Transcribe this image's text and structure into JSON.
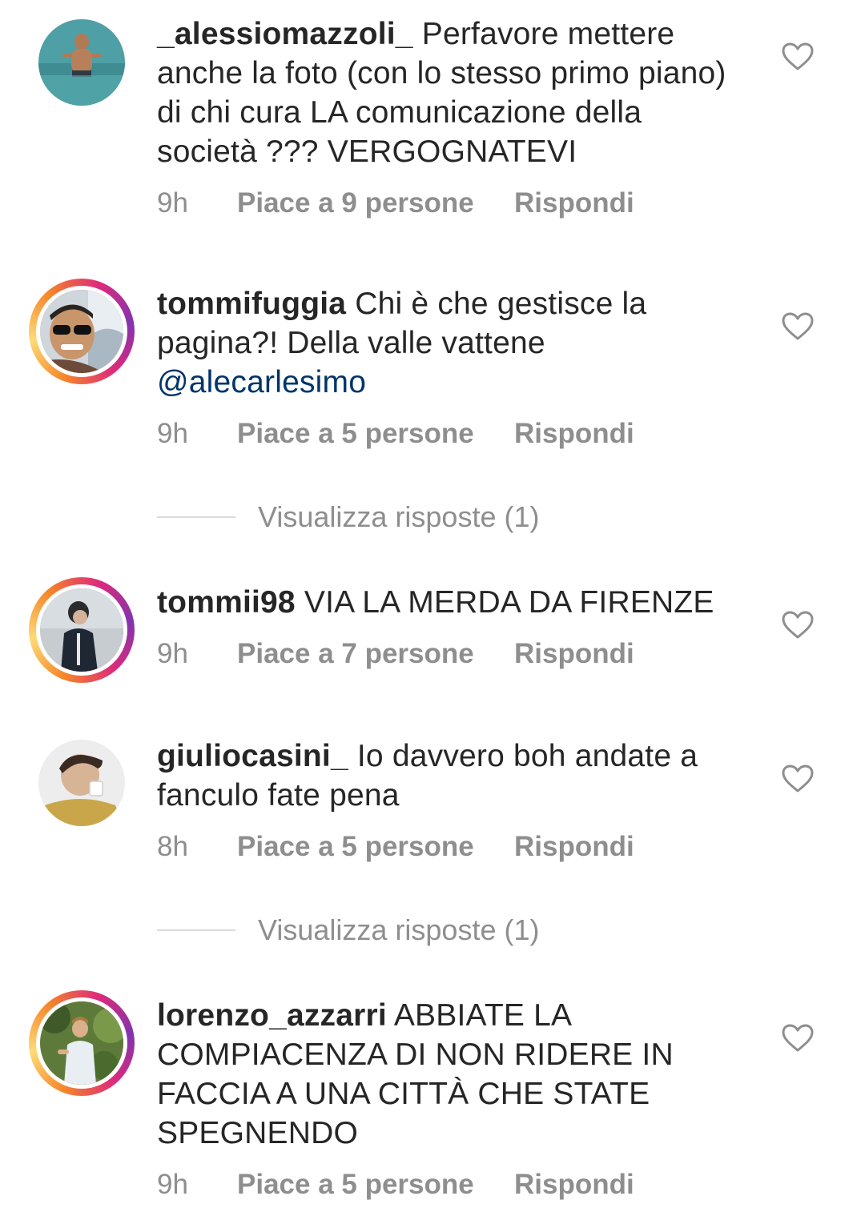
{
  "comments": [
    {
      "username": "_alessiomazzoli_",
      "text": "Perfavore mettere anche la foto (con lo stesso primo piano) di chi cura LA comunicazione della società ??? VERGOGNATEVI",
      "time": "9h",
      "likes": "Piace a 9 persone",
      "reply": "Rispondi"
    },
    {
      "username": "tommifuggia",
      "text": "Chi è che gestisce la pagina?! Della valle vattene",
      "mention": "@alecarlesimo",
      "time": "9h",
      "likes": "Piace a 5 persone",
      "reply": "Rispondi",
      "view_replies": "Visualizza risposte (1)"
    },
    {
      "username": "tommii98",
      "text": "VIA LA MERDA DA FIRENZE",
      "time": "9h",
      "likes": "Piace a 7 persone",
      "reply": "Rispondi"
    },
    {
      "username": "giuliocasini_",
      "text": "Io davvero boh andate a fanculo fate pena",
      "time": "8h",
      "likes": "Piace a 5 persone",
      "reply": "Rispondi",
      "view_replies": "Visualizza risposte (1)"
    },
    {
      "username": "lorenzo_azzarri",
      "text": "ABBIATE LA COMPIACENZA DI NON RIDERE IN FACCIA A UNA CITTÀ CHE STATE SPEGNENDO",
      "time": "9h",
      "likes": "Piace a 5 persone",
      "reply": "Rispondi"
    }
  ],
  "icons": {
    "like": "heart-outline-icon"
  },
  "colors": {
    "text": "#262626",
    "meta": "#8e8e8e",
    "mention": "#003569",
    "divider": "#dbdbdb"
  }
}
